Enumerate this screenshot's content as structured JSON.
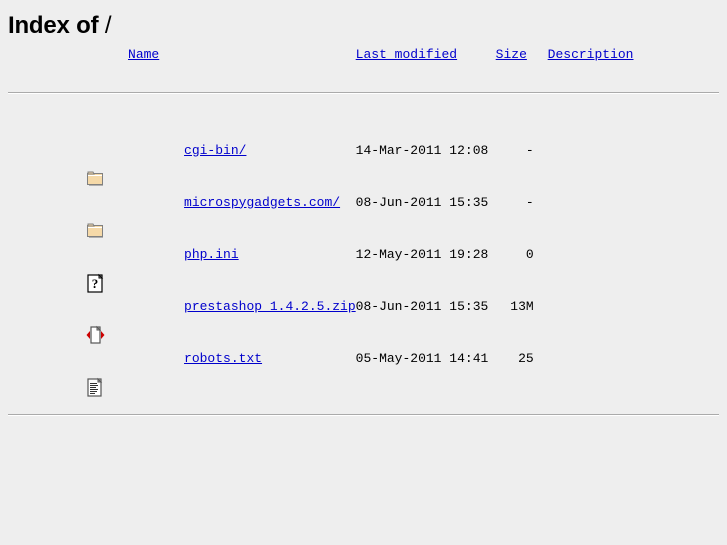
{
  "header": {
    "title_prefix": "Index of",
    "path": "/"
  },
  "table": {
    "columns": [
      {
        "key": "icon",
        "label": ""
      },
      {
        "key": "name",
        "label": "Name"
      },
      {
        "key": "date",
        "label": "Last modified"
      },
      {
        "key": "size",
        "label": "Size"
      },
      {
        "key": "desc",
        "label": "Description"
      }
    ],
    "rows": [
      {
        "icon": "folder-icon",
        "name": "cgi-bin/",
        "date": "14-Mar-2011 12:08",
        "size": "-",
        "desc": ""
      },
      {
        "icon": "folder-icon",
        "name": "microspygadgets.com/",
        "date": "08-Jun-2011 15:35",
        "size": "-",
        "desc": ""
      },
      {
        "icon": "unknown-file-icon",
        "name": "php.ini",
        "date": "12-May-2011 19:28",
        "size": "0",
        "desc": ""
      },
      {
        "icon": "compressed-file-icon",
        "name": "prestashop 1.4.2.5.zip",
        "date": "08-Jun-2011 15:35",
        "size": "13M",
        "desc": ""
      },
      {
        "icon": "text-file-icon",
        "name": "robots.txt",
        "date": "05-May-2011 14:41",
        "size": "25",
        "desc": ""
      }
    ]
  },
  "colors": {
    "background": "#eeeeee",
    "link": "#0000cc",
    "text": "#000000",
    "rule": "#aaaaaa",
    "folder_face": "#f5d9a8",
    "folder_edge": "#808080",
    "compressed_arrow": "#cc0000"
  }
}
